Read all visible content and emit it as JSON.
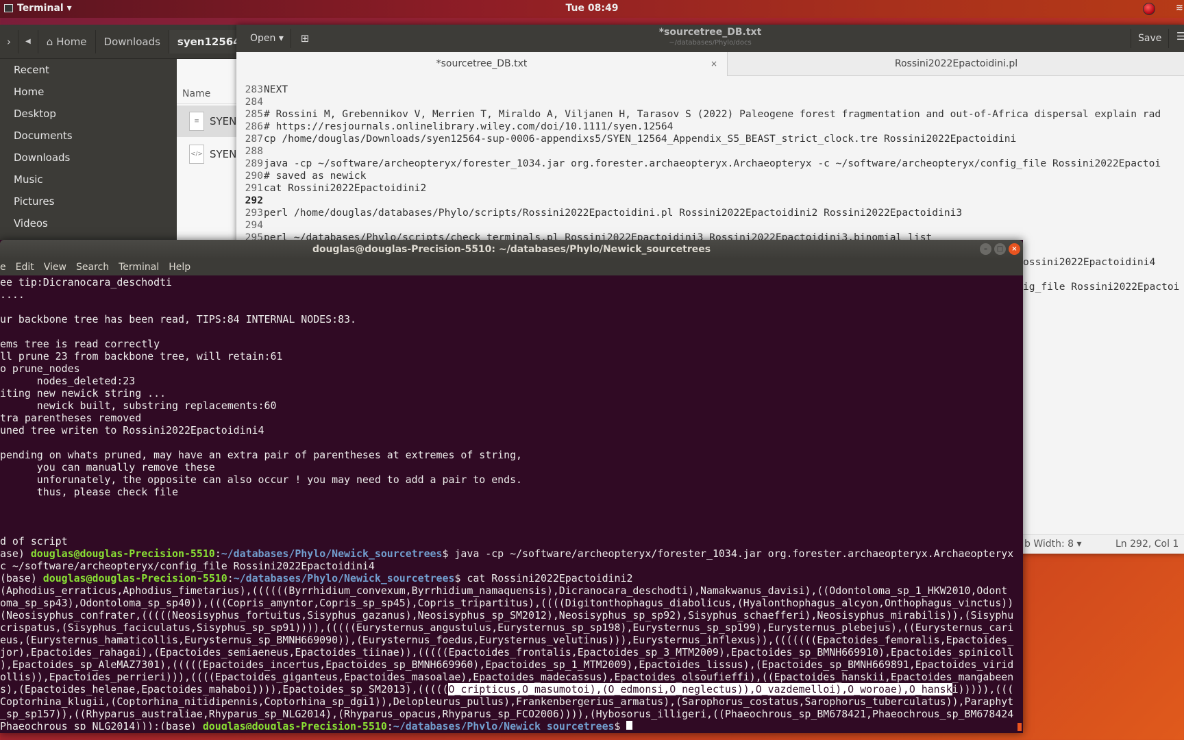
{
  "topbar": {
    "app_label": "Terminal ▾",
    "clock": "Tue 08:49",
    "record_icon": "record-indicator-icon",
    "network_icon": "wifi-icon"
  },
  "file_manager": {
    "breadcrumb": [
      "Home",
      "Downloads",
      "syen12564-"
    ],
    "sidebar": [
      "Recent",
      "Home",
      "Desktop",
      "Documents",
      "Downloads",
      "Music",
      "Pictures",
      "Videos"
    ],
    "column_name": "Name",
    "files": [
      {
        "name": "SYEN",
        "icon": "text-file-icon"
      },
      {
        "name": "SYEN",
        "icon": "xml-file-icon"
      }
    ]
  },
  "editor": {
    "open_label": "Open ▾",
    "title": "*sourcetree_DB.txt",
    "subtitle": "~/databases/Phylo/docs",
    "save_label": "Save",
    "tabs": [
      {
        "label": "*sourcetree_DB.txt",
        "close": "×"
      },
      {
        "label": "Rossini2022Epactoidini.pl"
      }
    ],
    "current_line": "292",
    "lines": [
      {
        "n": "283",
        "t": "NEXT"
      },
      {
        "n": "284",
        "t": ""
      },
      {
        "n": "285",
        "t": "# Rossini M, Grebennikov V, Merrien T, Miraldo A, Viljanen H, Tarasov S (2022) Paleogene forest fragmentation and out-of-Africa dispersal explain rad"
      },
      {
        "n": "286",
        "t": "# https://resjournals.onlinelibrary.wiley.com/doi/10.1111/syen.12564"
      },
      {
        "n": "287",
        "t": "cp /home/douglas/Downloads/syen12564-sup-0006-appendixs5/SYEN_12564_Appendix_S5_BEAST_strict_clock.tre Rossini2022Epactoidini"
      },
      {
        "n": "288",
        "t": ""
      },
      {
        "n": "289",
        "t": "java -cp ~/software/archeopteryx/forester_1034.jar org.forester.archaeopteryx.Archaeopteryx -c ~/software/archeopteryx/config_file Rossini2022Epactoi"
      },
      {
        "n": "290",
        "t": "# saved as newick"
      },
      {
        "n": "291",
        "t": "cat Rossini2022Epactoidini2"
      },
      {
        "n": "292",
        "t": ""
      },
      {
        "n": "293",
        "t": "perl /home/douglas/databases/Phylo/scripts/Rossini2022Epactoidini.pl Rossini2022Epactoidini2 Rossini2022Epactoidini3"
      },
      {
        "n": "294",
        "t": ""
      },
      {
        "n": "295",
        "t": "perl ~/databases/Phylo/scripts/check_terminals.pl Rossini2022Epactoidini3 Rossini2022Epactoidini3.binomial_list"
      }
    ],
    "hidden_fragments": [
      "ossini2022Epactoidini4",
      "ig_file Rossini2022Epactoi"
    ],
    "status": {
      "tab_width": "b Width: 8 ▾",
      "position": "Ln 292, Col 1"
    }
  },
  "terminal": {
    "title": "douglas@douglas-Precision-5510: ~/databases/Phylo/Newick_sourcetrees",
    "menu": [
      "e",
      "Edit",
      "View",
      "Search",
      "Terminal",
      "Help"
    ],
    "prompt_user": "douglas@douglas-Precision-5510",
    "prompt_path": "~/databases/Phylo/Newick_sourcetrees",
    "lines": [
      [
        {
          "t": "ee tip:Dicranocara_deschodti"
        }
      ],
      [
        {
          "t": "...."
        }
      ],
      [],
      [
        {
          "t": "ur backbone tree has been read, TIPS:84 INTERNAL NODES:83."
        }
      ],
      [],
      [
        {
          "t": "ems tree is read correctly"
        }
      ],
      [
        {
          "t": "ll prune 23 from backbone tree, will retain:61"
        }
      ],
      [
        {
          "t": "o prune_nodes"
        }
      ],
      [
        {
          "t": "      nodes_deleted:23"
        }
      ],
      [
        {
          "t": "iting new newick string ..."
        }
      ],
      [
        {
          "t": "      newick built, substring replacements:60"
        }
      ],
      [
        {
          "t": "tra parentheses removed"
        }
      ],
      [
        {
          "t": "uned tree writen to Rossini2022Epactoidini4"
        }
      ],
      [],
      [
        {
          "t": "pending on whats pruned, may have an extra pair of parentheses at extremes of string,"
        }
      ],
      [
        {
          "t": "      you can manually remove these"
        }
      ],
      [
        {
          "t": "      unforunately, the opposite can also occur ! you may need to add a pair to ends."
        }
      ],
      [
        {
          "t": "      thus, please check file"
        }
      ],
      [],
      [],
      [],
      [
        {
          "t": "d of script"
        }
      ],
      [
        {
          "t": "ase) "
        },
        {
          "t": "douglas@douglas-Precision-5510",
          "c": "g"
        },
        {
          "t": ":"
        },
        {
          "t": "~/databases/Phylo/Newick_sourcetrees",
          "c": "b"
        },
        {
          "t": "$ java -cp ~/software/archeopteryx/forester_1034.jar org.forester.archaeopteryx.Archaeopteryx"
        }
      ],
      [
        {
          "t": "c ~/software/archeopteryx/config_file Rossini2022Epactoidini4"
        }
      ],
      [
        {
          "t": "(base) "
        },
        {
          "t": "douglas@douglas-Precision-5510",
          "c": "g"
        },
        {
          "t": ":"
        },
        {
          "t": "~/databases/Phylo/Newick_sourcetrees",
          "c": "b"
        },
        {
          "t": "$ cat Rossini2022Epactoidini2"
        }
      ],
      [
        {
          "t": "(Aphodius_erraticus,Aphodius_fimetarius),((((((Byrrhidium_convexum,Byrrhidium_namaquensis),Dicranocara_deschodti),Namakwanus_davisi),((Odontoloma_sp_1_HKW2010,Odont"
        }
      ],
      [
        {
          "t": "oma_sp_sp43),Odontoloma_sp_sp40)),(((Copris_amyntor,Copris_sp_sp45),Copris_tripartitus),((((Digitonthophagus_diabolicus,(Hyalonthophagus_alcyon,Onthophagus_vinctus))"
        }
      ],
      [
        {
          "t": "(Neosisyphus_confrater,(((((Neosisyphus_fortuitus,Sisyphus_gazanus),Neosisyphus_sp_SM2012),Neosisyphus_sp_sp92),Sisyphus_schaefferi),Neosisyphus_mirabilis)),(Sisyphu"
        }
      ],
      [
        {
          "t": "crispatus,(Sisyphus_faciculatus,Sisyphus_sp_sp91)))),(((((Eurysternus_angustulus,Eurysternus_sp_sp198),Eurysternus_sp_sp199),Eurysternus_plebejus),((Eurysternus_cari"
        }
      ],
      [
        {
          "t": "eus,(Eurysternus_hamaticollis,Eurysternus_sp_BMNH669090)),(Eurysternus_foedus,Eurysternus_velutinus))),Eurysternus_inflexus)),(((((((Epactoides_femoralis,Epactoides_"
        }
      ],
      [
        {
          "t": "jor),Epactoides_rahagai),(Epactoides_semiaeneus,Epactoides_tiinae)),(((((Epactoides_frontalis,Epactoides_sp_3_MTM2009),Epactoides_sp_BMNH669910),Epactoides_spinicoll"
        }
      ],
      [
        {
          "t": "),Epactoides_sp_AleMAZ7301),(((((Epactoides_incertus,Epactoides_sp_BMNH669960),Epactoides_sp_1_MTM2009),Epactoides_lissus),(Epactoides_sp_BMNH669891,Epactoides_virid"
        }
      ],
      [
        {
          "t": "ollis)),Epactoides_perrieri))),((((Epactoides_giganteus,Epactoides_masoalae),Epactoides_madecassus),Epactoides_olsoufieffi),((Epactoides_hanskii,Epactoides_mangabeen"
        }
      ],
      [
        {
          "t": "s),(Epactoides_helenae,Epactoides_mahaboi)))),Epactoides_sp_SM2013),((((("
        },
        {
          "t": "O_cripticus,O_masumotoi),(O_edmonsi,O_neglectus)),O_vazdemelloi),O_woroae),O_hansk",
          "c": "sel"
        },
        {
          "t": "i))))),((("
        }
      ],
      [
        {
          "t": "Coptorhina_klugii,(Coptorhina_nitidipennis,Coptorhina_sp_dgi1)),Delopleurus_pullus),Frankenbergerius_armatus),(Sarophorus_costatus,Sarophorus_tuberculatus)),Paraphyt"
        }
      ],
      [
        {
          "t": "_sp_sp157)),((Rhyparus_australiae,Rhyparus_sp_NLG2014),(Rhyparus_opacus,Rhyparus_sp_FCO2006)))),(Hybosorus_illigeri,((Phaeochrous_sp_BM678421,Phaeochrous_sp_BM678424"
        }
      ],
      [
        {
          "t": "Phaeochrous_sp_NLG2014)));(base) "
        },
        {
          "t": "douglas@douglas-Precision-5510",
          "c": "g"
        },
        {
          "t": ":"
        },
        {
          "t": "~/databases/Phylo/Newick_sourcetrees",
          "c": "b"
        },
        {
          "t": "$ "
        },
        {
          "cursor": true
        }
      ]
    ]
  },
  "colors": {
    "terminal_bg": "#300a24",
    "prompt_user": "#8ae234",
    "prompt_path": "#729fcf",
    "accent": "#e95420"
  }
}
